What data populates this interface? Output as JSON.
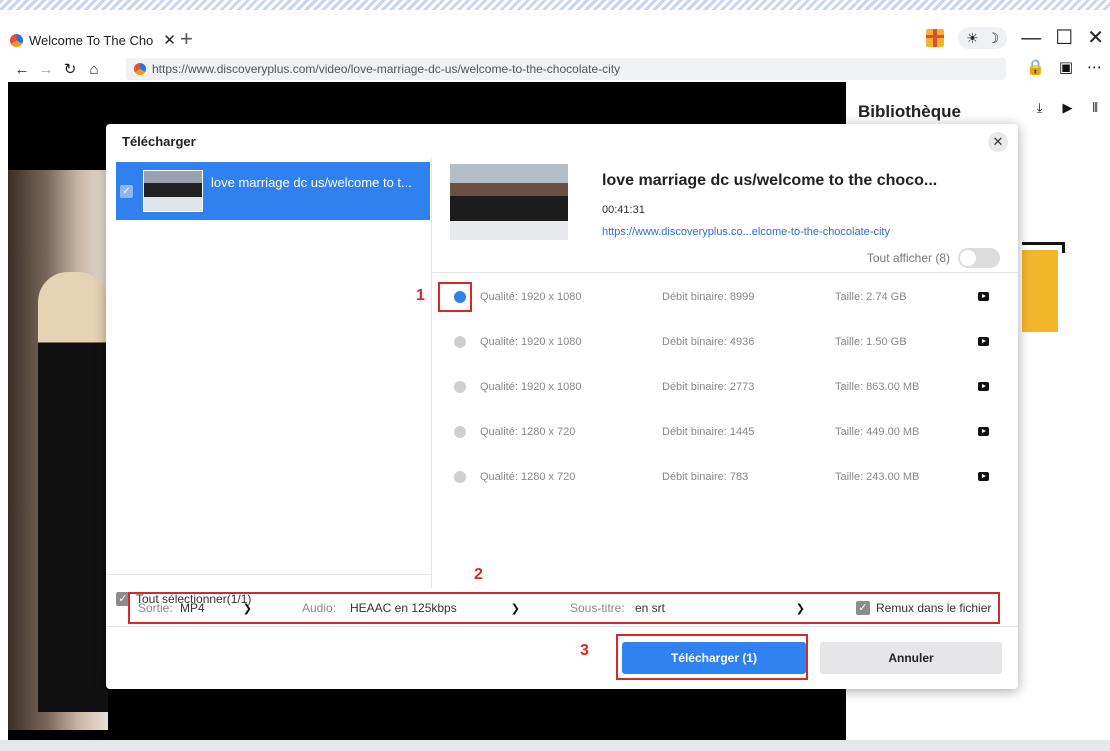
{
  "browser": {
    "tab_title": "Welcome To The Cho",
    "tab_close": "✕",
    "new_tab": "+",
    "url": "https://www.discoveryplus.com/video/love-marriage-dc-us/welcome-to-the-chocolate-city"
  },
  "library": {
    "title": "Bibliothèque"
  },
  "dialog": {
    "title": "Télécharger",
    "close": "✕",
    "video_item_title": "love marriage dc us/welcome to t...",
    "detail_title": "love marriage dc us/welcome to the choco...",
    "duration": "00:41:31",
    "detail_url": "https://www.discoveryplus.co...elcome-to-the-chocolate-city",
    "show_all_label": "Tout afficher (8)",
    "select_all_label": "Tout sélectionner(1/1)",
    "qualities": [
      {
        "quality": "Qualité: 1920 x 1080",
        "bitrate": "Débit binaire: 8999",
        "size": "Taille: 2.74 GB",
        "selected": true
      },
      {
        "quality": "Qualité: 1920 x 1080",
        "bitrate": "Débit binaire: 4936",
        "size": "Taille: 1.50 GB",
        "selected": false
      },
      {
        "quality": "Qualité: 1920 x 1080",
        "bitrate": "Débit binaire: 2773",
        "size": "Taille: 863.00 MB",
        "selected": false
      },
      {
        "quality": "Qualité: 1280 x 720",
        "bitrate": "Débit binaire: 1445",
        "size": "Taille: 449.00 MB",
        "selected": false
      },
      {
        "quality": "Qualité: 1280 x 720",
        "bitrate": "Débit binaire: 783",
        "size": "Taille: 243.00 MB",
        "selected": false
      }
    ],
    "output_label": "Sortie:",
    "output_value": "MP4",
    "audio_label": "Audio:",
    "audio_value": "HEAAC en 125kbps",
    "subtitle_label": "Sous-titre:",
    "subtitle_value": "en srt",
    "remux_label": "Remux dans le fichier",
    "download_button": "Télécharger (1)",
    "cancel_button": "Annuler"
  },
  "annotations": [
    "1",
    "2",
    "3"
  ],
  "colors": {
    "accent": "#2f81f0",
    "annotation": "#d62828"
  }
}
